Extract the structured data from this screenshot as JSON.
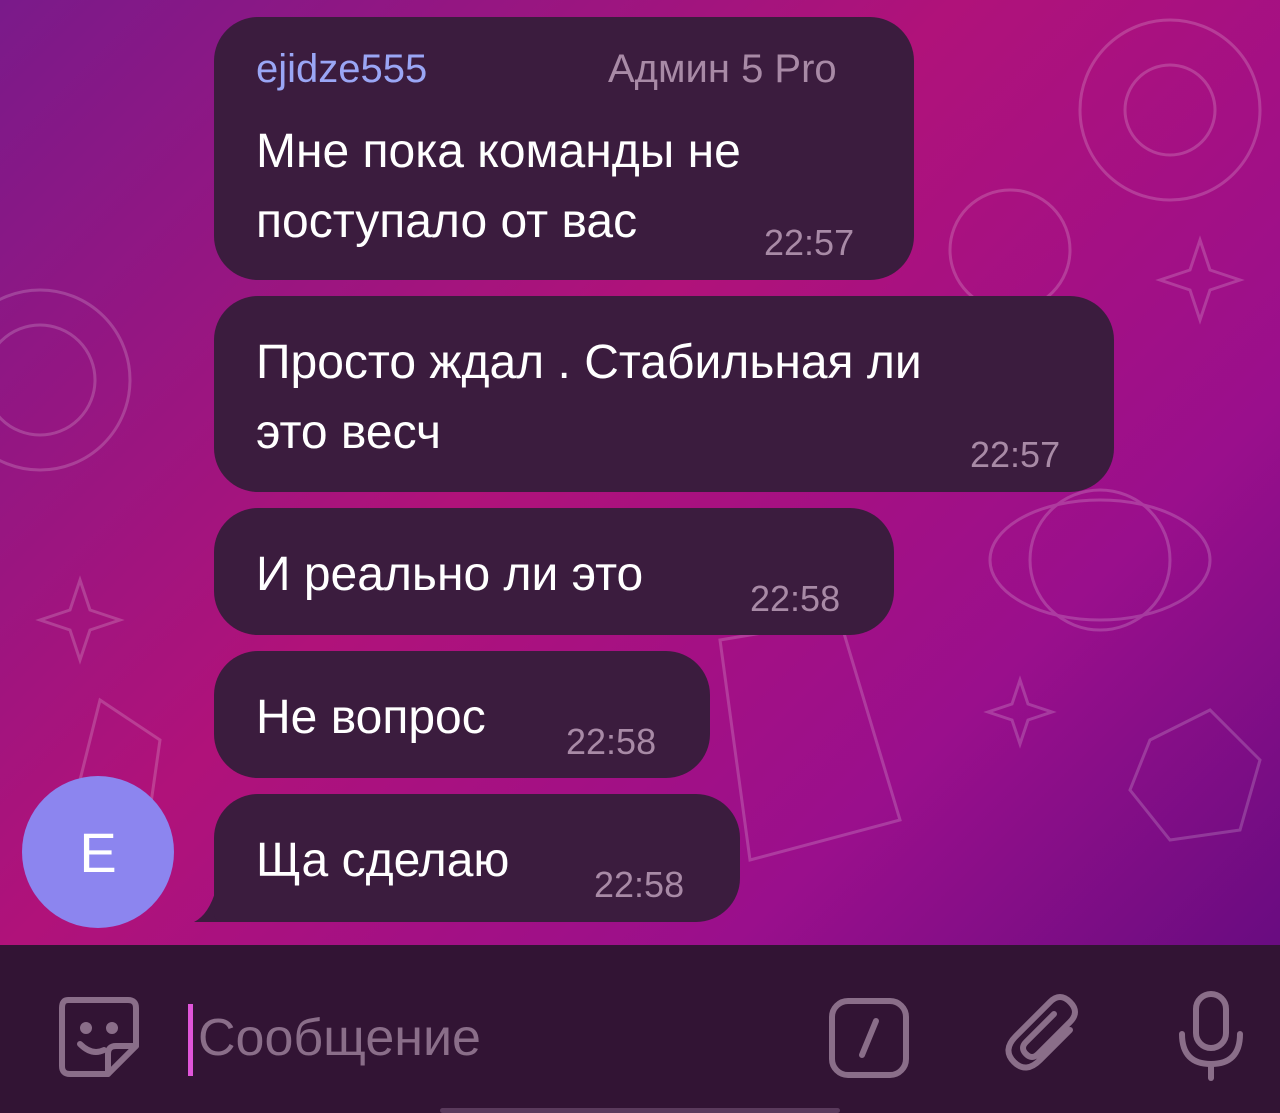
{
  "messages": [
    {
      "sender": "ejidze555",
      "badge": "Админ 5 Pro",
      "lines": [
        "Мне пока команды не",
        "поступало от вас"
      ],
      "time": "22:57"
    },
    {
      "lines": [
        "Просто ждал . Стабильная ли",
        "это весч"
      ],
      "time": "22:57"
    },
    {
      "lines": [
        "И реально ли это"
      ],
      "time": "22:58"
    },
    {
      "lines": [
        "Не вопрос"
      ],
      "time": "22:58"
    },
    {
      "lines": [
        "Ща сделаю"
      ],
      "time": "22:58"
    }
  ],
  "avatar": {
    "letter": "E",
    "color": "#8c85ef"
  },
  "input": {
    "placeholder": "Сообщение"
  },
  "icons": {
    "emoji": "sticker-emoji-icon",
    "commands": "bot-commands-icon",
    "attach": "paperclip-icon",
    "voice": "microphone-icon"
  },
  "colors": {
    "bubble": "#3b1c3e",
    "sender": "#9aa6f5",
    "time": "#a88aa6",
    "caret": "#e055d9"
  }
}
